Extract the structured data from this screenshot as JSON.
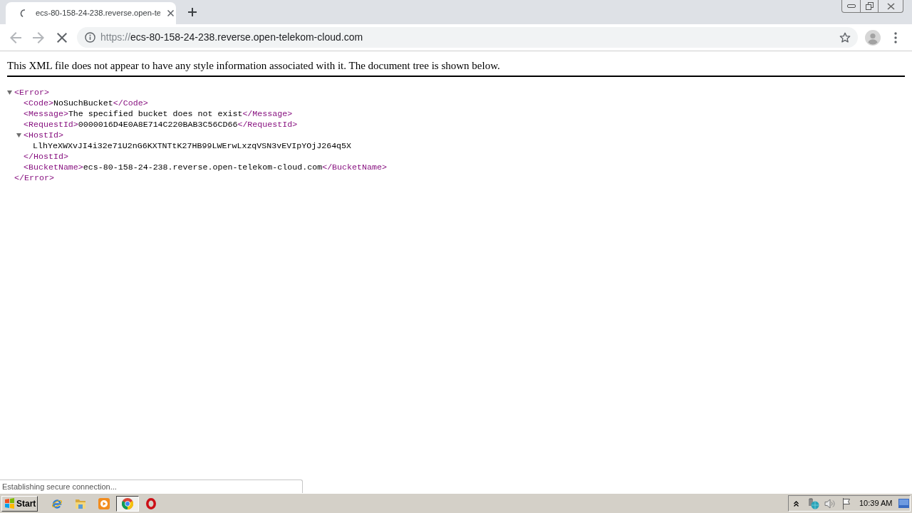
{
  "browser": {
    "loading": true
  },
  "tabs": [
    {
      "title": "ecs-80-158-24-238.reverse.open-te",
      "selected": true
    }
  ],
  "address_bar": {
    "scheme": "https://",
    "host": "ecs-80-158-24-238.reverse.open-telekom-cloud.com"
  },
  "xml_viewer": {
    "notice": "This XML file does not appear to have any style information associated with it. The document tree is shown below.",
    "tree": [
      {
        "kind": "block",
        "open": "<Error>",
        "close": "</Error>",
        "expanded": true,
        "children": [
          {
            "kind": "inline",
            "open": "<Code>",
            "text": "NoSuchBucket",
            "close": "</Code>"
          },
          {
            "kind": "inline",
            "open": "<Message>",
            "text": "The specified bucket does not exist",
            "close": "</Message>"
          },
          {
            "kind": "inline",
            "open": "<RequestId>",
            "text": "0000016D4E0A8E714C220BAB3C56CD66",
            "close": "</RequestId>"
          },
          {
            "kind": "block",
            "open": "<HostId>",
            "close": "</HostId>",
            "expanded": true,
            "children": [
              {
                "kind": "text",
                "text": "LlhYeXWXvJI4i32e71U2nG6KXTNTtK27HB99LWErwLxzqVSN3vEVIpYOjJ264q5X"
              }
            ]
          },
          {
            "kind": "inline",
            "open": "<BucketName>",
            "text": "ecs-80-158-24-238.reverse.open-telekom-cloud.com",
            "close": "</BucketName>"
          }
        ]
      }
    ]
  },
  "status_bubble": {
    "text": "Establishing secure connection..."
  },
  "taskbar": {
    "start_label": "Start",
    "apps": [
      {
        "kind": "ie",
        "selected": false
      },
      {
        "kind": "explorer",
        "selected": false
      },
      {
        "kind": "player",
        "selected": false
      },
      {
        "kind": "chrome",
        "selected": true
      },
      {
        "kind": "opera",
        "selected": false
      }
    ],
    "clock": "10:39 AM"
  }
}
